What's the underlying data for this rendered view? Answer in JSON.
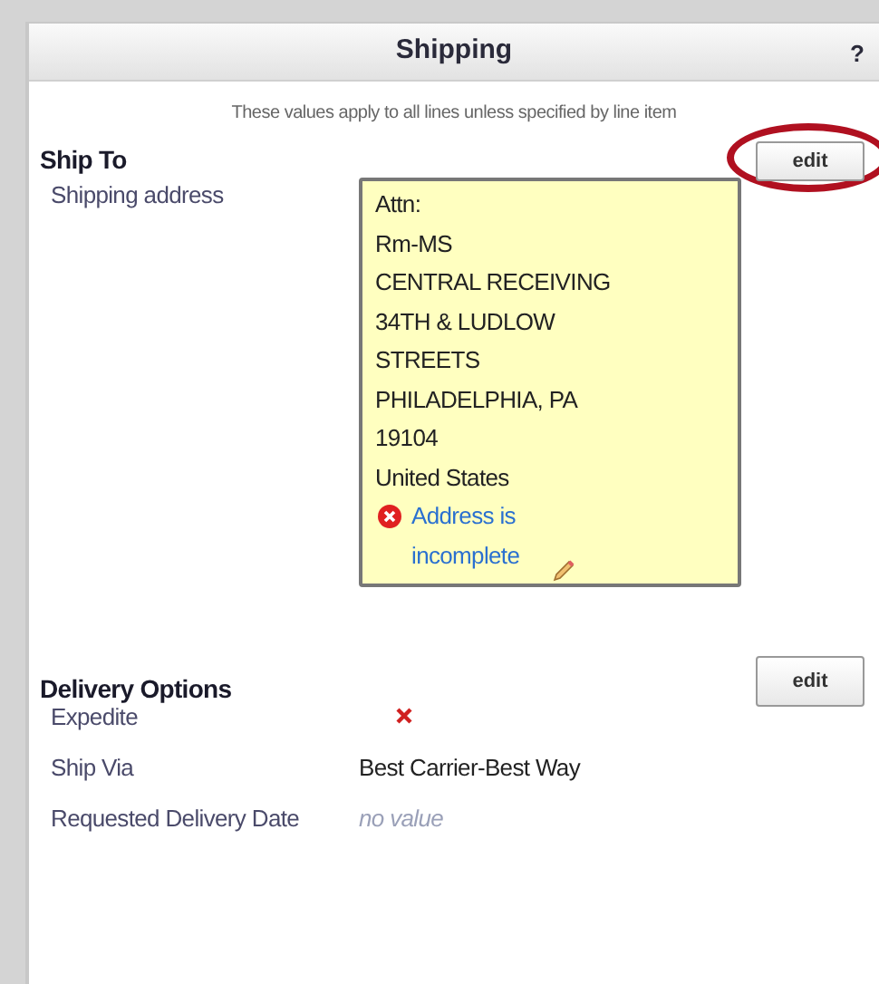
{
  "panel": {
    "title": "Shipping",
    "help": "?",
    "note": "These values apply to all lines unless specified by line item"
  },
  "ship_to": {
    "heading": "Ship To",
    "edit_button": {
      "label": "edit",
      "highlighted": true
    },
    "label": "Shipping address",
    "address_lines": [
      "Attn:",
      "Rm-MS",
      "CENTRAL RECEIVING",
      "34TH & LUDLOW",
      "STREETS",
      "PHILADELPHIA, PA",
      "19104",
      "United States"
    ],
    "warning": "Address is incomplete"
  },
  "delivery_options": {
    "heading": "Delivery Options",
    "edit_button": {
      "label": "edit",
      "highlighted": false
    },
    "fields": [
      {
        "kind": "flag",
        "label": "Expedite",
        "checked": false
      },
      {
        "kind": "text",
        "label": "Ship Via",
        "value": "Best Carrier-Best Way",
        "empty": false
      },
      {
        "kind": "text",
        "label": "Requested Delivery Date",
        "value": "no value",
        "empty": true
      }
    ]
  }
}
